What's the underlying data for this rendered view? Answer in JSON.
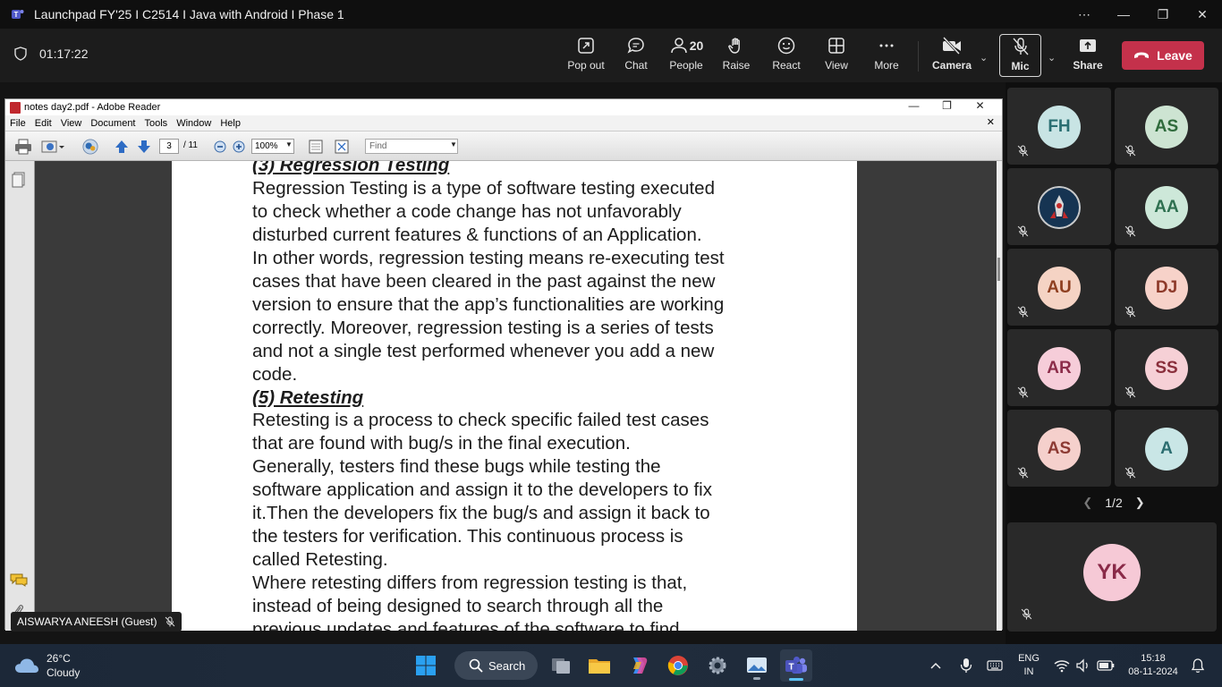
{
  "window": {
    "title": "Launchpad FY'25 I C2514 I Java with Android I Phase 1",
    "controls": [
      "...",
      "minimize",
      "maximize",
      "close"
    ]
  },
  "meeting": {
    "timer": "01:17:22",
    "toolbar": {
      "popout": "Pop out",
      "chat": "Chat",
      "people": "People",
      "people_count": "20",
      "raise": "Raise",
      "react": "React",
      "view": "View",
      "more": "More",
      "camera": "Camera",
      "mic": "Mic",
      "share": "Share",
      "leave": "Leave"
    },
    "leave_color": "#c4314b"
  },
  "reader": {
    "title": "notes day2.pdf - Adobe Reader",
    "menu": [
      "File",
      "Edit",
      "View",
      "Document",
      "Tools",
      "Window",
      "Help"
    ],
    "page_current": "3",
    "page_total": "/ 11",
    "zoom": "100%",
    "find_placeholder": "Find",
    "content": [
      {
        "type": "heading",
        "text": "(3) Regression Testing"
      },
      {
        "type": "line",
        "text": "Regression Testing is a type of software testing executed"
      },
      {
        "type": "line",
        "text": "to check whether a code change has not unfavorably"
      },
      {
        "type": "line",
        "text": "disturbed current features & functions of an Application."
      },
      {
        "type": "line",
        "text": "In other words, regression testing means re-executing test"
      },
      {
        "type": "line",
        "text": "cases that have been cleared in the past against the new"
      },
      {
        "type": "line",
        "text": "version to ensure that the app’s functionalities are working"
      },
      {
        "type": "line",
        "text": "correctly. Moreover, regression testing is a series of tests"
      },
      {
        "type": "line",
        "text": "and not a single test performed whenever you add a new"
      },
      {
        "type": "line",
        "text": "code."
      },
      {
        "type": "heading",
        "text": "(5) Retesting"
      },
      {
        "type": "line",
        "text": "Retesting is a process to check specific failed test cases"
      },
      {
        "type": "line",
        "text": "that are found with bug/s in the final execution."
      },
      {
        "type": "line",
        "text": "Generally, testers find these bugs while testing the"
      },
      {
        "type": "line",
        "text": "software application and assign it to the developers to fix"
      },
      {
        "type": "line",
        "text": "it.Then the developers fix the bug/s and assign it back to"
      },
      {
        "type": "line",
        "text": "the testers for verification. This continuous process is"
      },
      {
        "type": "line",
        "text": "called Retesting."
      },
      {
        "type": "line",
        "text": "Where retesting differs from regression testing is that,"
      },
      {
        "type": "line",
        "text": "instead of being designed to search through all the"
      },
      {
        "type": "line",
        "text": "previous updates and features of the software to find"
      }
    ]
  },
  "presenter_name": "AISWARYA ANEESH (Guest)",
  "participants": [
    {
      "initials": "FH",
      "bg": "#c8e4e4",
      "fg": "#2a6f72"
    },
    {
      "initials": "AS",
      "bg": "#cde4d2",
      "fg": "#2f6b3c"
    },
    {
      "initials": "",
      "bg": "#1a3a5c",
      "fg": "#ffffff",
      "icon": "avatar-image"
    },
    {
      "initials": "AA",
      "bg": "#cde8d9",
      "fg": "#2e7050"
    },
    {
      "initials": "AU",
      "bg": "#f5d3c4",
      "fg": "#8f3f20"
    },
    {
      "initials": "DJ",
      "bg": "#f7d2c9",
      "fg": "#8e3a2a"
    },
    {
      "initials": "AR",
      "bg": "#f6cdd9",
      "fg": "#8c2d4a"
    },
    {
      "initials": "SS",
      "bg": "#f6d0d6",
      "fg": "#8a2f3c"
    },
    {
      "initials": "AS",
      "bg": "#f5d0cc",
      "fg": "#8d3a33"
    },
    {
      "initials": "A",
      "bg": "#c9e6e6",
      "fg": "#2b6d70"
    }
  ],
  "gallery_page": "1/2",
  "self": {
    "initials": "YK"
  },
  "taskbar": {
    "weather_temp": "26°C",
    "weather_desc": "Cloudy",
    "search": "Search",
    "lang_top": "ENG",
    "lang_bottom": "IN",
    "time": "15:18",
    "date": "08-11-2024"
  }
}
